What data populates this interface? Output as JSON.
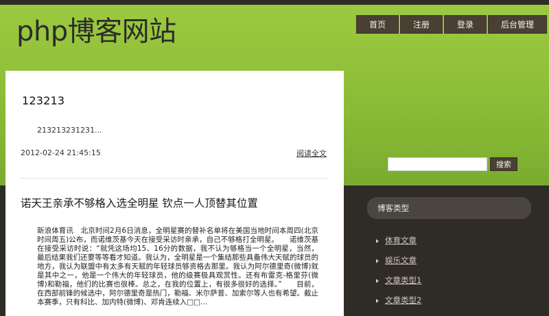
{
  "header": {
    "site_title": "php博客网站",
    "nav": [
      "首页",
      "注册",
      "登录",
      "后台管理"
    ]
  },
  "search": {
    "value": "",
    "placeholder": "",
    "button_label": "搜索"
  },
  "posts": [
    {
      "title": "123213",
      "excerpt": "213213231231...",
      "date": "2012-02-24 21:45:15",
      "read_more": "阅读全文"
    },
    {
      "title": "诺天王亲承不够格入选全明星 钦点一人顶替其位置",
      "body": "新浪体育讯　北京时间2月6日消息，全明星赛的替补名单将在美国当地时间本周四(北京时间周五)公布，而诺维茨基今天在接受采访时亲承，自己不够格打全明星。　　诺维茨基在接受采访时说：“就凭这场均15、16分的数据，我不认为够格当一个全明星，当然，最后结果我们还要等等看才知道。我认为，全明星是一个集结那些具备伟大天赋的球员的地方，我认为联盟中有太多有天赋的年轻球员够资格去那里。我认为阿尔德里奇(微博)就是其中之一，他是一个伟大的年轻球员，他的级赛极具观赏性。还有布雷克-格里芬(微博)和勒福，他们的比赛也很棒。总之，在我的位置上，有很多很好的选择。”　　目前，在西部前锋的候选中，阿尔德里奇是热门，勒福、米尔萨普、加索尔等人也有希望。截止本赛季，只有科比、加内特(微博)、邓肯连续入□□..."
    }
  ],
  "sidebar": {
    "header": "博客类型",
    "categories": [
      "体育文章",
      "娱乐文章",
      "文章类型1",
      "文章类型2"
    ]
  }
}
